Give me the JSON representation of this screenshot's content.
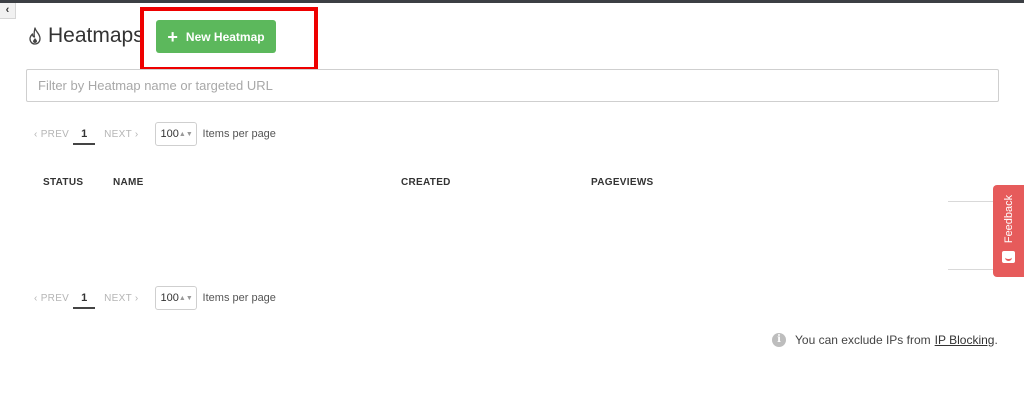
{
  "page": {
    "title": "Heatmaps",
    "new_button_label": "New Heatmap",
    "filter_placeholder": "Filter by Heatmap name or targeted URL"
  },
  "pagination": {
    "prev_label": "‹ PREV",
    "current_page": "1",
    "next_label": "NEXT ›",
    "per_page_value": "100",
    "per_page_label": "Items per page"
  },
  "table": {
    "columns": [
      "STATUS",
      "NAME",
      "CREATED",
      "PAGEVIEWS"
    ]
  },
  "feedback_tab": {
    "label": "Feedback"
  },
  "ip_note": {
    "text": "You can exclude IPs from",
    "link_label": "IP Blocking",
    "trailing": "."
  },
  "icons": {
    "title": "flame-icon",
    "new_button": "plus-icon",
    "collapse": "chevron-left-icon",
    "info": "info-circle-icon",
    "feedback": "smile-chat-icon"
  },
  "colors": {
    "primary_button": "#5cb85c",
    "feedback_tab": "#e65b5b",
    "highlight_annotation": "#ee0000"
  }
}
